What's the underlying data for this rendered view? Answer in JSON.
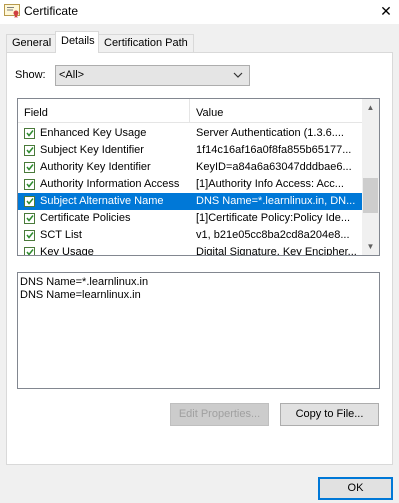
{
  "window": {
    "title": "Certificate",
    "close_glyph": "✕"
  },
  "tabs": [
    {
      "label": "General",
      "active": false
    },
    {
      "label": "Details",
      "active": true
    },
    {
      "label": "Certification Path",
      "active": false
    }
  ],
  "show": {
    "label": "Show:",
    "selected": "<All>"
  },
  "fields_table": {
    "headers": {
      "field": "Field",
      "value": "Value"
    },
    "rows": [
      {
        "field": "Enhanced Key Usage",
        "value": "Server Authentication (1.3.6....",
        "icon": "certificate-field-icon"
      },
      {
        "field": "Subject Key Identifier",
        "value": "1f14c16af16a0f8fa855b65177...",
        "icon": "certificate-field-icon"
      },
      {
        "field": "Authority Key Identifier",
        "value": "KeyID=a84a6a63047dddbae6...",
        "icon": "certificate-field-icon"
      },
      {
        "field": "Authority Information Access",
        "value": "[1]Authority Info Access: Acc...",
        "icon": "certificate-field-icon"
      },
      {
        "field": "Subject Alternative Name",
        "value": "DNS Name=*.learnlinux.in, DN...",
        "icon": "certificate-field-icon",
        "selected": true
      },
      {
        "field": "Certificate Policies",
        "value": "[1]Certificate Policy:Policy Ide...",
        "icon": "certificate-field-icon"
      },
      {
        "field": "SCT List",
        "value": "v1, b21e05cc8ba2cd8a204e8...",
        "icon": "certificate-field-icon"
      },
      {
        "field": "Key Usage",
        "value": "Digital Signature, Key Encipher...",
        "icon": "certificate-field-icon"
      }
    ]
  },
  "detail": {
    "lines": [
      "DNS Name=*.learnlinux.in",
      "DNS Name=learnlinux.in"
    ]
  },
  "buttons": {
    "edit_properties": "Edit Properties...",
    "copy_to_file": "Copy to File...",
    "ok": "OK"
  },
  "colors": {
    "selection": "#0078d7",
    "accent": "#0078d7"
  }
}
